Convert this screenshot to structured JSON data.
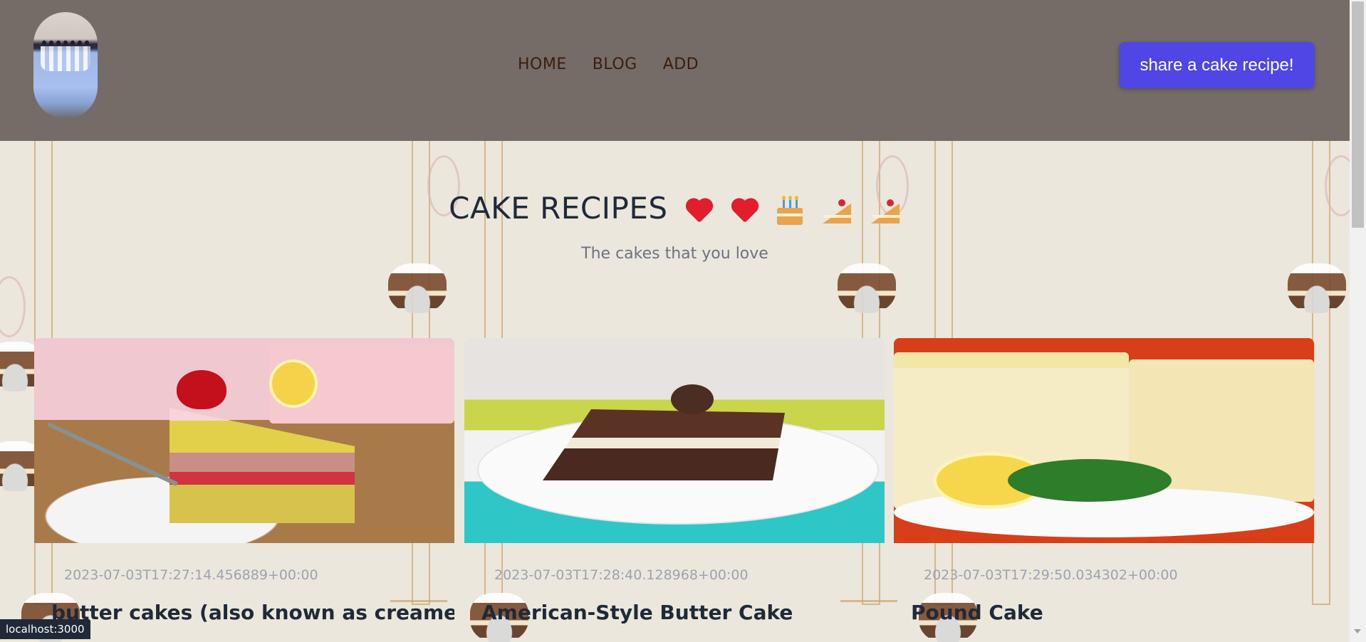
{
  "nav": {
    "items": [
      "HOME",
      "BLOG",
      "ADD"
    ],
    "share_label": "share a cake recipe!"
  },
  "hero": {
    "title": "CAKE RECIPES",
    "subtitle": "The cakes that you love",
    "icons": [
      "heart-icon",
      "heart-icon",
      "birthday-cake-icon",
      "cake-slice-icon",
      "cake-slice-icon"
    ]
  },
  "cards": [
    {
      "date": "2023-07-03T17:27:14.456889+00:00",
      "title": "butter cakes (also known as creamed cakes) and foam cakes"
    },
    {
      "date": "2023-07-03T17:28:40.128968+00:00",
      "title": "American-Style Butter Cake"
    },
    {
      "date": "2023-07-03T17:29:50.034302+00:00",
      "title": "Pound Cake"
    }
  ],
  "status_bar": "localhost:3000",
  "colors": {
    "header_bg": "#756c68",
    "accent": "#4f46e5",
    "nav_text": "#3b1d0d"
  }
}
